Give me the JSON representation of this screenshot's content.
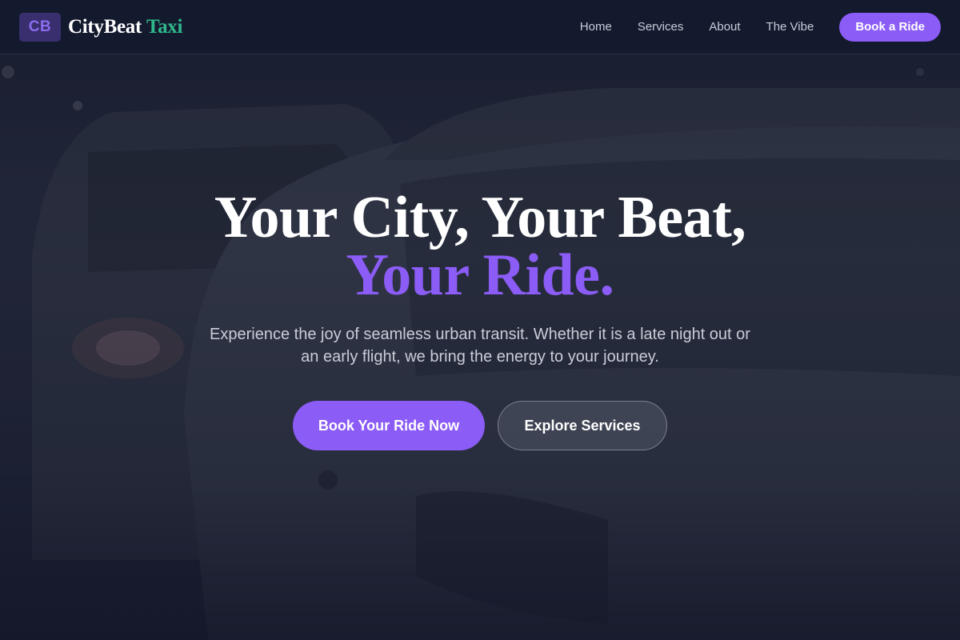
{
  "nav": {
    "logo_initials": "CB",
    "brand_name": "CityBeat",
    "brand_accent": "Taxi",
    "links": [
      {
        "label": "Home"
      },
      {
        "label": "Services"
      },
      {
        "label": "About"
      },
      {
        "label": "The Vibe"
      }
    ],
    "cta_label": "Book a Ride"
  },
  "hero": {
    "headline_line1": "Your City, Your Beat,",
    "headline_line2": "Your Ride.",
    "subtitle": "Experience the joy of seamless urban transit. Whether it is a late night out or an early flight, we bring the energy to your journey.",
    "primary_button": "Book Your Ride Now",
    "secondary_button": "Explore Services",
    "background_image": "dark-city-taxi-cars-photo"
  },
  "colors": {
    "background": "#141a2e",
    "accent_purple": "#8b5cf6",
    "accent_green": "#2fb88c",
    "logo_badge": "#3a2f6e",
    "text_light": "#c9cdd8"
  }
}
